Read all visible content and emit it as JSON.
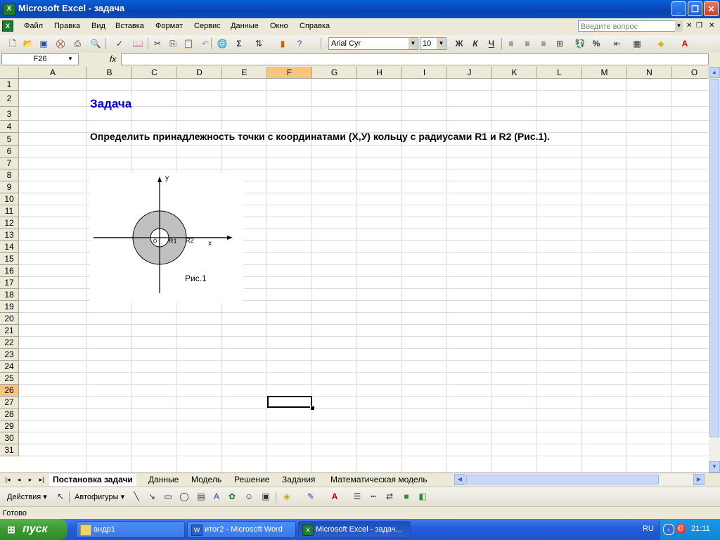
{
  "window": {
    "title": "Microsoft Excel - задача",
    "app_icon": "X"
  },
  "menu": [
    "Файл",
    "Правка",
    "Вид",
    "Вставка",
    "Формат",
    "Сервис",
    "Данные",
    "Окно",
    "Справка"
  ],
  "help_box": {
    "placeholder": "Введите вопрос"
  },
  "toolbar": {
    "font_name": "Arial Cyr",
    "font_size": "10",
    "bold": "Ж",
    "italic": "К",
    "underline": "Ч",
    "sum": "Σ",
    "percent": "%"
  },
  "formula_bar": {
    "name_box": "F26",
    "fx": "fx",
    "formula": ""
  },
  "columns": [
    "A",
    "B",
    "C",
    "D",
    "E",
    "F",
    "G",
    "H",
    "I",
    "J",
    "K",
    "L",
    "M",
    "N",
    "O"
  ],
  "selected_column": "F",
  "rows": [
    "1",
    "2",
    "3",
    "4",
    "5",
    "6",
    "7",
    "8",
    "9",
    "10",
    "11",
    "12",
    "13",
    "14",
    "15",
    "16",
    "17",
    "18",
    "19",
    "20",
    "21",
    "22",
    "23",
    "24",
    "25",
    "26",
    "27",
    "28",
    "29",
    "30",
    "31"
  ],
  "selected_row": "26",
  "cells": {
    "B2": "Задача",
    "B4": "Определить принадлежность точки с координатами (X,У) кольцу с радиусами R1 и R2 (Рис.1)."
  },
  "figure": {
    "y_label": "y",
    "x_label": "x",
    "origin_label": "0",
    "r1_label": "R1",
    "r2_label": "R2",
    "caption": "Рис.1"
  },
  "sheet_tabs": [
    "Постановка задачи",
    "Данные",
    "Модель",
    "Решение",
    "Задания",
    "Математическая модель"
  ],
  "active_tab": "Постановка задачи",
  "drawing_toolbar": {
    "actions": "Действия",
    "autoshapes": "Автофигуры"
  },
  "status_text": "Готово",
  "taskbar": {
    "start": "пуск",
    "buttons": [
      "андр1",
      "итог2 - Microsoft Word",
      "Microsoft Excel - задач..."
    ],
    "lang": "RU",
    "clock": "21:11"
  },
  "colors": {
    "heading_blue": "#0000cc",
    "selection_orange": "#f7c67a",
    "ring_gray": "#c0c0c0"
  }
}
